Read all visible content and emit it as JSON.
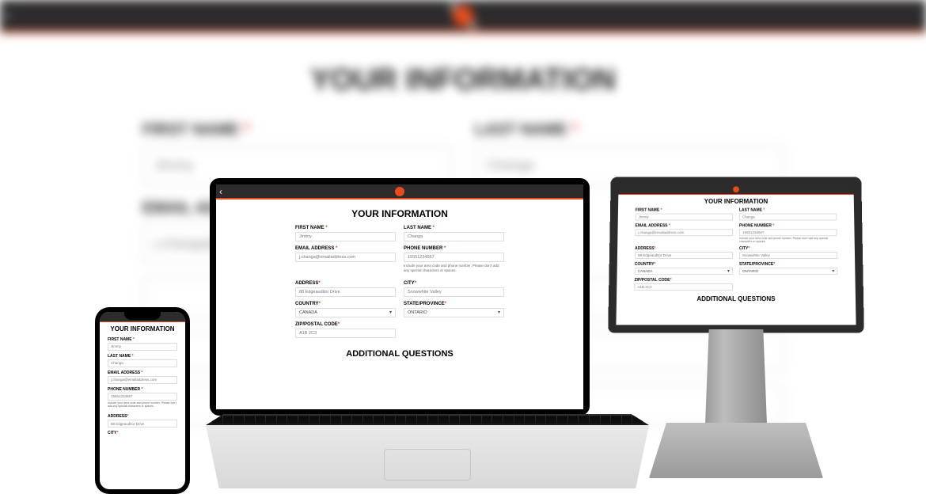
{
  "bg": {
    "title": "YOUR INFORMATION",
    "first_name_label": "FIRST NAME",
    "last_name_label": "LAST NAME",
    "email_label": "EMAIL ADDRESS",
    "first_name": "Jimmy",
    "last_name": "Changa",
    "email": "j.changa@..."
  },
  "form": {
    "title": "YOUR INFORMATION",
    "subtitle": "ADDITIONAL QUESTIONS",
    "labels": {
      "first_name": "FIRST NAME",
      "last_name": "LAST NAME",
      "email": "EMAIL ADDRESS",
      "phone": "PHONE NUMBER",
      "address": "ADDRESS",
      "city": "CITY",
      "country": "COUNTRY",
      "state": "STATE/PROVINCE",
      "zip": "ZIP/POSTAL CODE"
    },
    "values": {
      "first_name": "Jimmy",
      "last_name": "Changa",
      "email": "j.changa@emailaddress.com",
      "phone": "15551234567",
      "address": "88 Edgeauditor Drive",
      "city": "Snowwhite Valley",
      "country": "CANADA",
      "state": "ONTARIO",
      "zip": "A1B 2C3"
    },
    "hints": {
      "phone": "Include your area code and phone number. Please don't add any special characters or spaces."
    },
    "asterisk": "*"
  },
  "phone_title": "YOUR INFORMATION"
}
